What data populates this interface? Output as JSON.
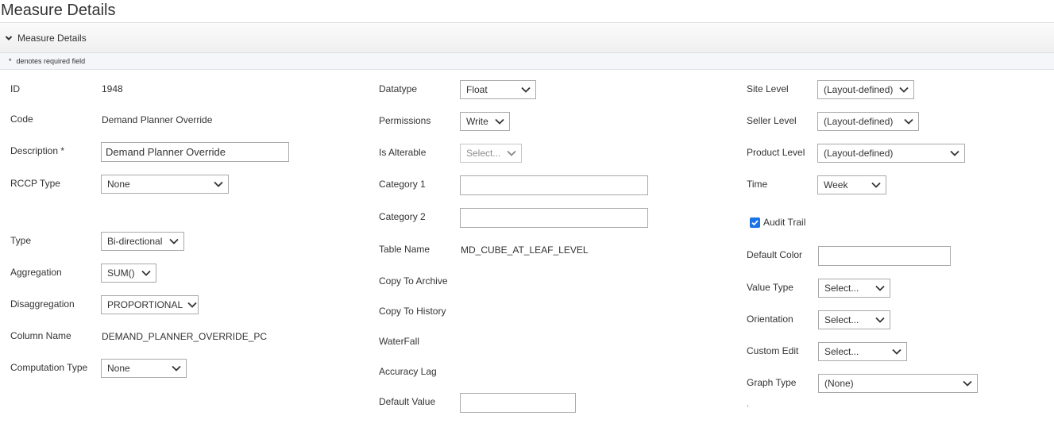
{
  "page": {
    "title": "Measure Details"
  },
  "panel": {
    "header": "Measure Details",
    "required_note": "denotes required field",
    "required_mark": "*"
  },
  "col1": {
    "id": {
      "label": "ID",
      "value": "1948"
    },
    "code": {
      "label": "Code",
      "value": "Demand Planner Override"
    },
    "description": {
      "label": "Description *",
      "value": "Demand Planner Override"
    },
    "rccp_type": {
      "label": "RCCP Type",
      "value": "None"
    },
    "type": {
      "label": "Type",
      "value": "Bi-directional"
    },
    "aggregation": {
      "label": "Aggregation",
      "value": "SUM()"
    },
    "disaggregation": {
      "label": "Disaggregation",
      "value": "PROPORTIONAL"
    },
    "column_name": {
      "label": "Column Name",
      "value": "DEMAND_PLANNER_OVERRIDE_PC"
    },
    "computation_type": {
      "label": "Computation Type",
      "value": "None"
    }
  },
  "col2": {
    "datatype": {
      "label": "Datatype",
      "value": "Float"
    },
    "permissions": {
      "label": "Permissions",
      "value": "Write"
    },
    "is_alterable": {
      "label": "Is Alterable",
      "value": "Select..."
    },
    "category1": {
      "label": "Category 1",
      "value": ""
    },
    "category2": {
      "label": "Category 2",
      "value": ""
    },
    "table_name": {
      "label": "Table Name",
      "value": "MD_CUBE_AT_LEAF_LEVEL"
    },
    "copy_to_archive": {
      "label": "Copy To Archive"
    },
    "copy_to_history": {
      "label": "Copy To History"
    },
    "waterfall": {
      "label": "WaterFall"
    },
    "accuracy_lag": {
      "label": "Accuracy Lag"
    },
    "default_value": {
      "label": "Default Value",
      "value": ""
    }
  },
  "col3": {
    "site_level": {
      "label": "Site Level",
      "value": "(Layout-defined)"
    },
    "seller_level": {
      "label": "Seller Level",
      "value": "(Layout-defined)"
    },
    "product_level": {
      "label": "Product Level",
      "value": "(Layout-defined)"
    },
    "time": {
      "label": "Time",
      "value": "Week"
    },
    "audit_trail": {
      "label": "Audit Trail",
      "checked": true
    },
    "default_color": {
      "label": "Default Color",
      "value": ""
    },
    "value_type": {
      "label": "Value Type",
      "value": "Select..."
    },
    "orientation": {
      "label": "Orientation",
      "value": "Select..."
    },
    "custom_edit": {
      "label": "Custom Edit",
      "value": "Select..."
    },
    "graph_type": {
      "label": "Graph Type",
      "value": "(None)"
    },
    "trailing_mark": "."
  },
  "colors": {
    "accent": "#1a73e8",
    "border": "#a9a9a9",
    "text": "#333333"
  }
}
